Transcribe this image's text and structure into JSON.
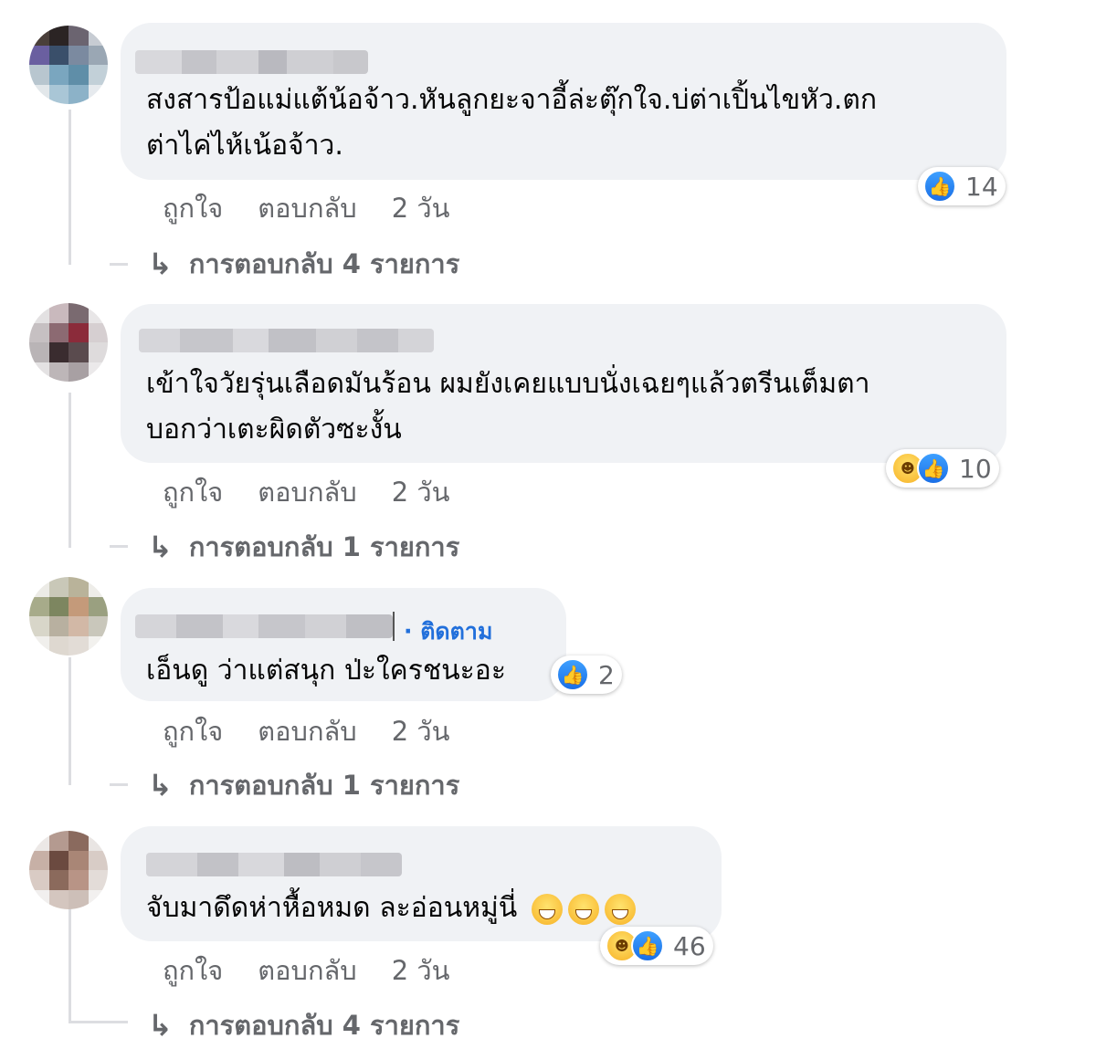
{
  "colors": {
    "link_blue": "#216fdb",
    "muted": "#65676b",
    "bubble": "#f0f2f5",
    "line": "#dcdde1"
  },
  "comments": [
    {
      "text_lines": [
        "สงสารป้อแม่แต้น้อจ้าว.หันลูกยะจาอี้ล่ะตุ๊กใจ.บ่ต่าเปิ้นไขหัว.ตก",
        "ต่าไค่ไห้เน้อจ้าว."
      ],
      "reactions": {
        "icons": [
          "like-icon"
        ],
        "count": "14"
      },
      "actions": {
        "like": "ถูกใจ",
        "reply": "ตอบกลับ",
        "time": "2 วัน"
      },
      "replies_label": "การตอบกลับ 4 รายการ"
    },
    {
      "text_lines": [
        "เข้าใจวัยรุ่นเลือดมันร้อน ผมยังเคยแบบนั่งเฉยๆแล้วตรีนเต็มตา",
        "บอกว่าเตะผิดตัวซะงั้น"
      ],
      "reactions": {
        "icons": [
          "haha-icon",
          "like-icon"
        ],
        "count": "10"
      },
      "actions": {
        "like": "ถูกใจ",
        "reply": "ตอบกลับ",
        "time": "2 วัน"
      },
      "replies_label": "การตอบกลับ 1 รายการ"
    },
    {
      "follow_label": "· ติดตาม",
      "text_lines": [
        "เอ็นดู ว่าแต่สนุก ป่ะใครชนะอะ"
      ],
      "reactions": {
        "icons": [
          "like-icon"
        ],
        "count": "2"
      },
      "actions": {
        "like": "ถูกใจ",
        "reply": "ตอบกลับ",
        "time": "2 วัน"
      },
      "replies_label": "การตอบกลับ 1 รายการ"
    },
    {
      "text_lines": [
        "จับมาดึดห่าหื้อหมด ละอ่อนหมู่นี่"
      ],
      "emoji_trail": [
        "grin-emoji",
        "grin-emoji",
        "grin-emoji"
      ],
      "reactions": {
        "icons": [
          "haha-icon",
          "like-icon"
        ],
        "count": "46"
      },
      "actions": {
        "like": "ถูกใจ",
        "reply": "ตอบกลับ",
        "time": "2 วัน"
      },
      "replies_label": "การตอบกลับ 4 รายการ"
    }
  ]
}
